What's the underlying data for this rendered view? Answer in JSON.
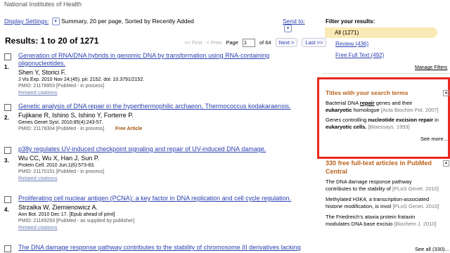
{
  "header": {
    "org": "National Institutes of Health"
  },
  "display_bar": {
    "settings_label": "Display Settings:",
    "summary": "Summary, 20 per page, Sorted by Recently Added",
    "send_to": "Send to:"
  },
  "results": {
    "heading": "Results: 1 to 20 of 1271",
    "pager": {
      "first": "<< First",
      "prev": "< Prev",
      "page_label": "Page",
      "page_value": "1",
      "of": "of 64",
      "next": "Next >",
      "last": "Last >>"
    },
    "items": [
      {
        "num": "1.",
        "title1": "Generation of RNA/DNA hybrids in genomic DNA by transformation using RNA-containing",
        "title2": "oligonucleotides.",
        "authors": "Shen Y, Storici F.",
        "cite": "J Vis Exp. 2010 Nov 24;(45). pii: 2152. doi: 10.3791/2152.",
        "pmid": "PMID: 21178953 [PubMed - in process]",
        "related": "Related citations"
      },
      {
        "num": "2.",
        "title1": "Genetic analysis of DNA repair in the hyperthermophilic archaeon, Thermococcus kodakaraensis.",
        "authors": "Fujikane R, Ishino S, Ishino Y, Forterre P.",
        "cite": "Genes Genet Syst. 2010;85(4):243-57.",
        "pmid": "PMID: 21178304 [PubMed - in process]",
        "free": "Free Article"
      },
      {
        "num": "3.",
        "title1": "p38y regulates UV-induced checkpoint signaling and repair of UV-induced DNA damage.",
        "authors": "Wu CC, Wu X, Han J, Sun P.",
        "cite": "Protein Cell. 2010 Jun;1(6):573-83.",
        "pmid": "PMID: 21170151 [PubMed - in process]",
        "related": "Related citations"
      },
      {
        "num": "4.",
        "title1": "Proliferating cell nuclear antigen (PCNA): a key factor in DNA replication and cell cycle regulation.",
        "authors": "Strzalka W, Ziemienowicz A.",
        "cite": "Ann Bot. 2010 Dec 17. [Epub ahead of print]",
        "pmid": "PMID: 21169293 [PubMed - as supplied by publisher]",
        "related": "Related citations"
      },
      {
        "title1": "The DNA damage response pathway contributes to the stability of chromosome III derivatives lacking"
      }
    ]
  },
  "filters": {
    "heading": "Filter your results:",
    "all": "All (1271)",
    "review": "Review (436)",
    "free_full_text": "Free Full Text (492)",
    "manage": "Manage Filters"
  },
  "titles_box": {
    "heading": "Titles with your search terms",
    "snippets": [
      {
        "l1a": "Bacterial DNA ",
        "l1b": "repair",
        "l1c": " genes and their",
        "l2a": "eukaryotic",
        "l2b": " homologue",
        "l2src": " [Acta Biochim Pol. 2007]"
      },
      {
        "l1a": "Genes controlling ",
        "l1b": "nucleotide excision repair",
        "l1c": " in",
        "l2a": "eukaryotic cells.",
        "l2b": "",
        "l2src": " [Bioessays. 1993]"
      }
    ],
    "see_more": "See more..."
  },
  "free_articles": {
    "heading": "330 free full-text articles in PubMed Central",
    "snippets": [
      {
        "l1": "The DNA damage response pathway",
        "l2": "contributes to the stability of",
        "src": " [PLoS Genet. 2010]"
      },
      {
        "l1": "Methylated H3K4, a transcription-associated",
        "l2": "histone modification, is invol",
        "src": " [PLoS Genet. 2010]"
      },
      {
        "l1": "The Friedreich's ataxia protein frataxin",
        "l2": "modulates DNA base excisio",
        "src": " [Biochem J. 2010]"
      }
    ],
    "see_all": "See all (330)..."
  }
}
